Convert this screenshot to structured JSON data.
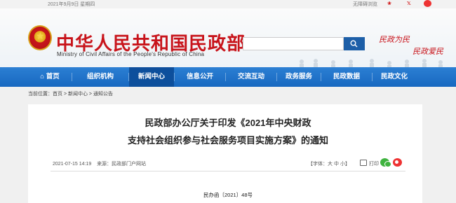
{
  "topbar": {
    "date": "2021年9月9日 星期四",
    "accessibility": "无障碍浏览",
    "weibo_label": "Weibo",
    "twitter_label": "Tw"
  },
  "header": {
    "title_cn": "中华人民共和国民政部",
    "title_en": "Ministry of Civil Affairs of the People's Republic of China",
    "slogan_line1": "民政为民",
    "slogan_line2": "民政爱民",
    "search_placeholder": ""
  },
  "nav": {
    "items": [
      {
        "label": "首页"
      },
      {
        "label": "组织机构"
      },
      {
        "label": "新闻中心"
      },
      {
        "label": "信息公开"
      },
      {
        "label": "交流互动"
      },
      {
        "label": "政务服务"
      },
      {
        "label": "民政数据"
      },
      {
        "label": "民政文化"
      }
    ],
    "active_index": 2
  },
  "breadcrumb": "当前位置：首页 > 新闻中心 > 通知公告",
  "article": {
    "title_line1": "民政部办公厅关于印发《2021年中央财政",
    "title_line2": "支持社会组织参与社会服务项目实施方案》的通知",
    "date": "2021-07-15 14:19",
    "source": "来源：民政部门户网站",
    "font_size_label": "【字体：大  中  小】",
    "print_label": "打印",
    "doc_number": "民办函〔2021〕48号"
  },
  "colors": {
    "brand_red": "#c8141b",
    "nav_blue": "#1868c0",
    "nav_active": "#0d4f9c"
  }
}
